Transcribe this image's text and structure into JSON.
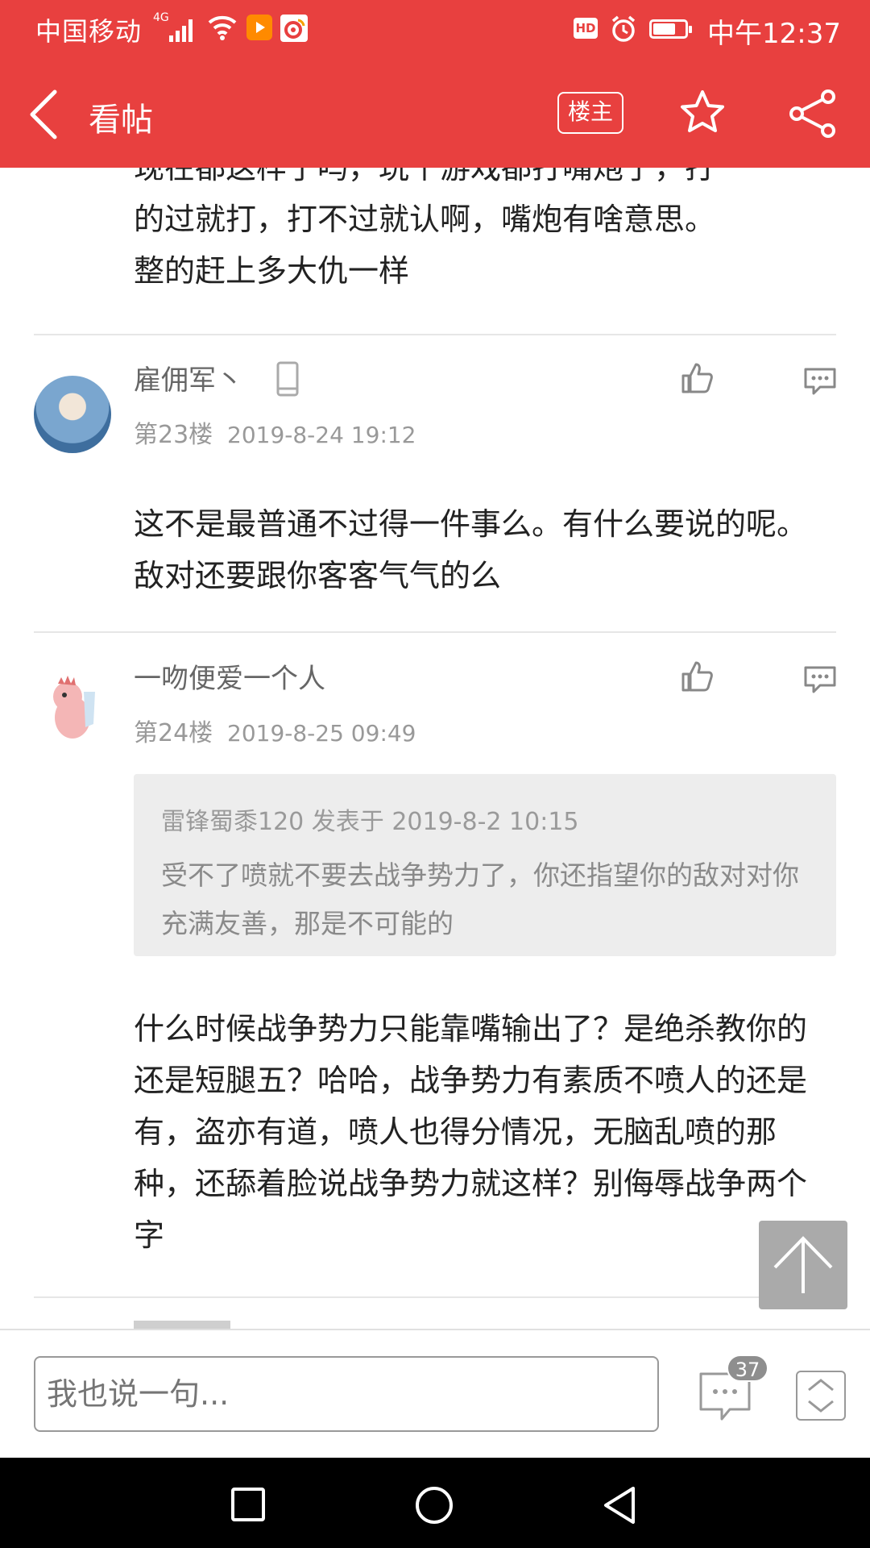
{
  "status_bar": {
    "carrier": "中国移动",
    "signal": "4G",
    "time": "中午12:37",
    "hd": "HD",
    "battery_level": 0.7
  },
  "nav": {
    "title": "看帖",
    "op_button": "楼主"
  },
  "prev_post": {
    "text_line1": "现在都这样了吗，玩个游戏都打嘴炮了，打",
    "text_line2": "的过就打，打不过就认啊，嘴炮有啥意思。",
    "text_line3": "整的赶上多大仇一样"
  },
  "posts": [
    {
      "author": "雇佣军丶",
      "floor": "第23楼",
      "date": "2019-8-24 19:12",
      "text": "这不是最普通不过得一件事么。有什么要说的呢。敌对还要跟你客客气气的么"
    },
    {
      "author": "一吻便爱一个人",
      "floor": "第24楼",
      "date": "2019-8-25 09:49",
      "quote": {
        "header": "雷锋蜀黍120 发表于 2019-8-2 10:15",
        "text": "受不了喷就不要去战争势力了，你还指望你的敌对对你充满友善，那是不可能的"
      },
      "text": "什么时候战争势力只能靠嘴输出了？是绝杀教你的还是短腿五？哈哈，战争势力有素质不喷人的还是有，盗亦有道，喷人也得分情况，无脑乱喷的那种，还舔着脸说战争势力就这样？别侮辱战争两个字"
    }
  ],
  "bottom_bar": {
    "input_placeholder": "我也说一句...",
    "comment_count": "37"
  },
  "colors": {
    "brand_red": "#e8403f"
  }
}
